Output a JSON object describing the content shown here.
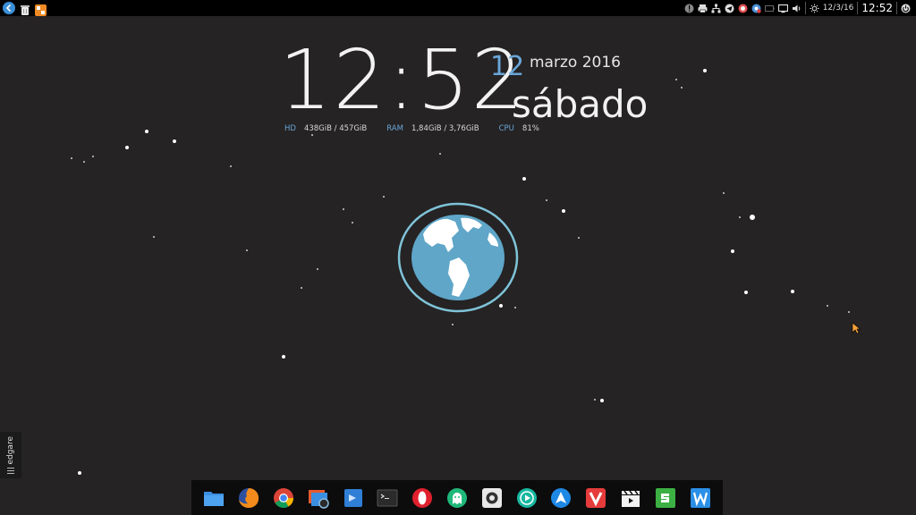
{
  "top_panel": {
    "date": "12/3/16",
    "time": "12:52"
  },
  "clock_widget": {
    "time": "12:52",
    "day": "12",
    "month_year": "marzo 2016",
    "weekday": "sábado",
    "stats": [
      {
        "label": "HD",
        "value": "438GiB / 457GiB"
      },
      {
        "label": "RAM",
        "value": "1,84GiB / 3,76GiB"
      },
      {
        "label": "CPU",
        "value": "81%"
      }
    ]
  },
  "side_panel": {
    "label": "edgare"
  },
  "dock": {
    "items": [
      {
        "name": "files",
        "icon": "folder-icon"
      },
      {
        "name": "firefox",
        "icon": "firefox-icon"
      },
      {
        "name": "chrome",
        "icon": "chrome-icon"
      },
      {
        "name": "image-viewer",
        "icon": "image-viewer-icon"
      },
      {
        "name": "mail",
        "icon": "mail-icon"
      },
      {
        "name": "terminal",
        "icon": "terminal-icon"
      },
      {
        "name": "opera",
        "icon": "opera-icon"
      },
      {
        "name": "ghost",
        "icon": "ghost-icon"
      },
      {
        "name": "settings",
        "icon": "settings-icon"
      },
      {
        "name": "media-player",
        "icon": "play-icon"
      },
      {
        "name": "app-store",
        "icon": "app-store-icon"
      },
      {
        "name": "vivaldi",
        "icon": "vivaldi-icon"
      },
      {
        "name": "video-editor",
        "icon": "clapperboard-icon"
      },
      {
        "name": "spreadsheet",
        "icon": "spreadsheet-icon"
      },
      {
        "name": "writer",
        "icon": "writer-icon"
      }
    ]
  },
  "colors": {
    "background": "#252324",
    "accent": "#6aa6d8",
    "globe": "#5fa6c8"
  }
}
